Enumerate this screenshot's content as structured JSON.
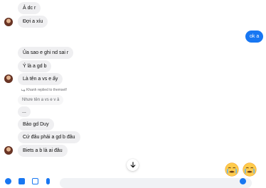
{
  "thread": {
    "messages": [
      {
        "id": "m1",
        "direction": "in",
        "text": "Ả dc r"
      },
      {
        "id": "m2",
        "direction": "in",
        "text": "Đợi a xíu"
      },
      {
        "id": "m3",
        "direction": "out",
        "text": "ok a"
      },
      {
        "id": "m4",
        "direction": "in",
        "text": "Ủa sao e ghi nd sai r"
      },
      {
        "id": "m5",
        "direction": "in",
        "text": "Ý là a gd b"
      },
      {
        "id": "m6",
        "direction": "in",
        "text": "Là tên a vs e ấy"
      },
      {
        "id": "m7",
        "direction": "in",
        "text": "..."
      },
      {
        "id": "m8",
        "direction": "in",
        "text": "Bảo gd Duy"
      },
      {
        "id": "m9",
        "direction": "in",
        "text": "Cứ đâu phải a gd b đâu"
      },
      {
        "id": "m10",
        "direction": "in",
        "text": "Biets a b là ai đâu"
      }
    ],
    "reply_info": {
      "label": "Khanh replied to themself",
      "quoted_text": "Nhưe tên a vs e v ả"
    }
  },
  "icons": {
    "scroll_down": "arrow-down-icon",
    "reaction_1": "crying-emoji",
    "reaction_2": "crying-emoji"
  },
  "colors": {
    "outgoing_bubble": "#1877f2",
    "incoming_bubble": "#efeff1",
    "accent": "#1877f2"
  }
}
